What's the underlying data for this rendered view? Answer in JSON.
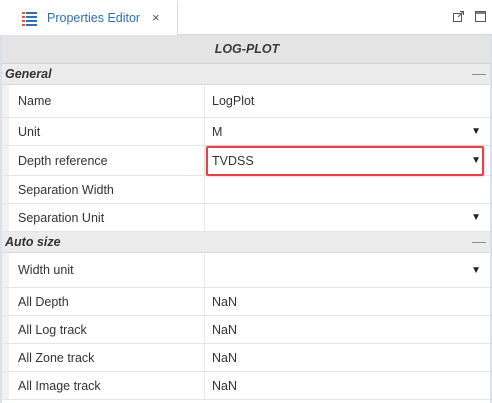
{
  "tab": {
    "label": "Properties Editor",
    "close_glyph": "×",
    "icon": "properties-grid-icon"
  },
  "window_controls": {
    "popout_icon": "popout-icon",
    "maximize_icon": "maximize-icon"
  },
  "title": "LOG-PLOT",
  "sections": {
    "general": {
      "label": "General",
      "toggle": "—"
    },
    "autosize": {
      "label": "Auto size",
      "toggle": "—"
    }
  },
  "rows": {
    "name": {
      "label": "Name",
      "value": "LogPlot"
    },
    "unit": {
      "label": "Unit",
      "value": "M",
      "arrow": "▼"
    },
    "depth_reference": {
      "label": "Depth reference",
      "value": "TVDSS",
      "arrow": "▼"
    },
    "separation_width": {
      "label": "Separation Width",
      "value": ""
    },
    "separation_unit": {
      "label": "Separation Unit",
      "value": "",
      "arrow": "▼"
    },
    "width_unit": {
      "label": "Width unit",
      "value": "",
      "arrow": "▼"
    },
    "all_depth": {
      "label": "All Depth",
      "value": "NaN"
    },
    "all_log_track": {
      "label": "All Log track",
      "value": "NaN"
    },
    "all_zone_track": {
      "label": "All Zone track",
      "value": "NaN"
    },
    "all_image_track": {
      "label": "All Image track",
      "value": "NaN"
    }
  },
  "colors": {
    "accent": "#2f6fb6",
    "highlight": "#e04447",
    "header_bg": "#e4e4e4"
  }
}
